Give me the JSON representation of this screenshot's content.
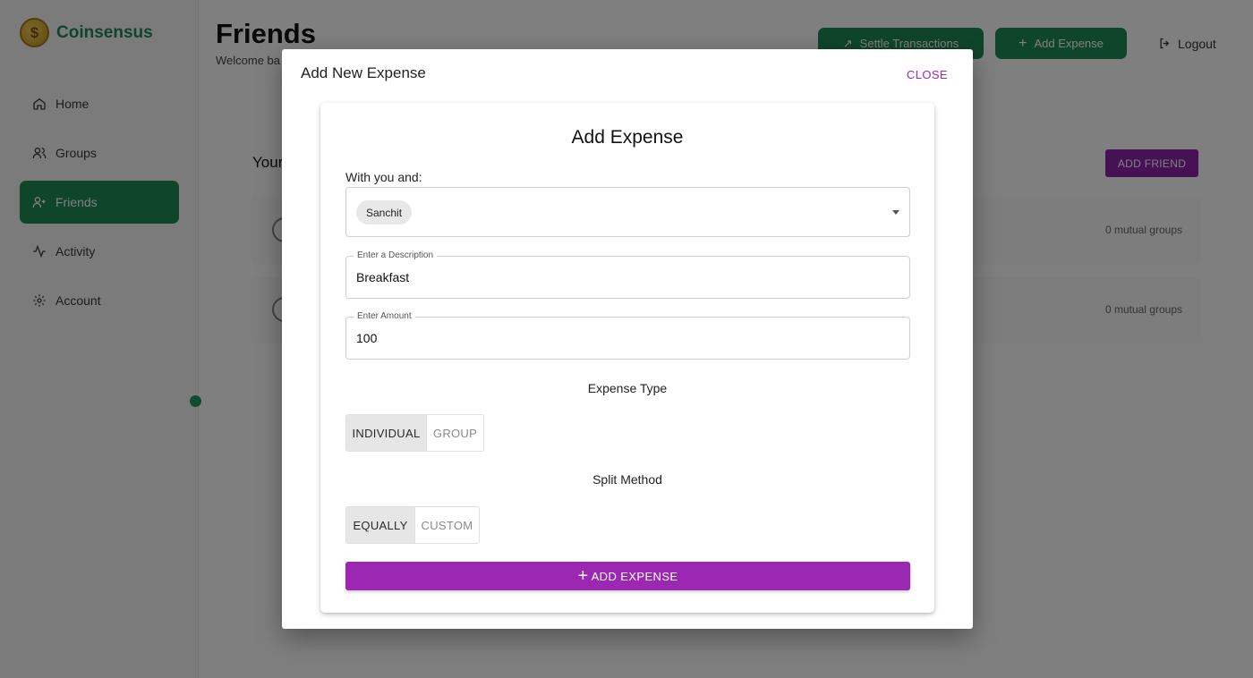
{
  "app": {
    "brand": "Coinsensus",
    "brand_icon": "dollar-coin-icon",
    "nav": [
      {
        "label": "Home",
        "icon": "home-icon",
        "active": false
      },
      {
        "label": "Groups",
        "icon": "users-icon",
        "active": false
      },
      {
        "label": "Friends",
        "icon": "user-plus-icon",
        "active": true
      },
      {
        "label": "Activity",
        "icon": "activity-icon",
        "active": false
      },
      {
        "label": "Account",
        "icon": "gear-icon",
        "active": false
      }
    ],
    "accent_green": "#1f8a57",
    "accent_purple": "#9c27b0"
  },
  "page": {
    "title": "Friends",
    "welcome": "Welcome ba",
    "settle_label": "Settle Transactions",
    "add_expense_label": "Add Expense",
    "logout_label": "Logout",
    "section_title": "Your",
    "add_friend_label": "ADD FRIEND",
    "friends": [
      {
        "mutual": "0 mutual groups"
      },
      {
        "mutual": "0 mutual groups"
      }
    ]
  },
  "dialog": {
    "title": "Add New Expense",
    "close_label": "CLOSE",
    "card_title": "Add Expense",
    "with_label": "With you and:",
    "selected_friend": "Sanchit",
    "description": {
      "label": "Enter a Description",
      "value": "Breakfast"
    },
    "amount": {
      "label": "Enter Amount",
      "value": "100"
    },
    "expense_type": {
      "label": "Expense Type",
      "options": [
        "INDIVIDUAL",
        "GROUP"
      ],
      "selected": "INDIVIDUAL"
    },
    "split_method": {
      "label": "Split Method",
      "options": [
        "EQUALLY",
        "CUSTOM"
      ],
      "selected": "EQUALLY"
    },
    "submit_label": "ADD EXPENSE"
  }
}
